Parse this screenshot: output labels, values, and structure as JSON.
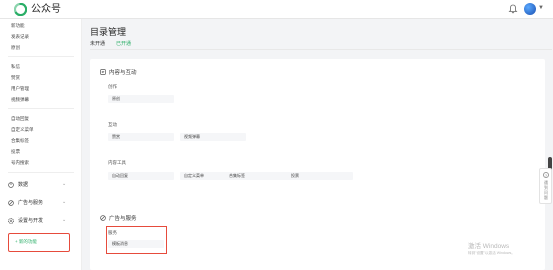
{
  "topbar": {
    "brand": "公众号",
    "colors": {
      "brand_green": "#2aae67"
    },
    "icons": [
      "wechat-mp-logo-icon",
      "bell-icon",
      "avatar",
      "chevron-down-icon"
    ]
  },
  "sidebar": {
    "items_top": [
      "新功能",
      "发表记录",
      "原创"
    ],
    "items_mid": [
      "私信",
      "赞赏",
      "用户管理",
      "视频弹幕"
    ],
    "items_low": [
      "自动回复",
      "自定义菜单",
      "合集标签",
      "投票",
      "号内搜索"
    ],
    "groups": [
      {
        "label": "数据",
        "icon": "data-icon"
      },
      {
        "label": "广告与服务",
        "icon": "ad-service-icon"
      },
      {
        "label": "设置与开发",
        "icon": "settings-icon"
      }
    ],
    "new_feature_button": "+ 新的功能"
  },
  "main": {
    "title": "目录管理",
    "tabs": [
      {
        "label": "未开通",
        "active": false
      },
      {
        "label": "已开通",
        "active": true
      }
    ],
    "section_interaction": {
      "title": "内容与互动",
      "groups": [
        {
          "label": "创作",
          "chips": [
            "原创"
          ]
        },
        {
          "label": "互动",
          "chips": [
            "赞赏",
            "视频弹幕"
          ]
        },
        {
          "label": "内容工具",
          "chips": [
            "自动回复",
            "自定义菜单",
            "合集标签",
            "投票"
          ]
        }
      ]
    },
    "section_ads": {
      "title": "广告与服务",
      "groups": [
        {
          "label": "服务",
          "chips": [
            "模板消息"
          ]
        }
      ]
    }
  },
  "help_tab": {
    "label": "遇到问题"
  },
  "watermark": {
    "line1": "激活 Windows",
    "line2": "转到\"设置\"以激活 Windows。"
  }
}
